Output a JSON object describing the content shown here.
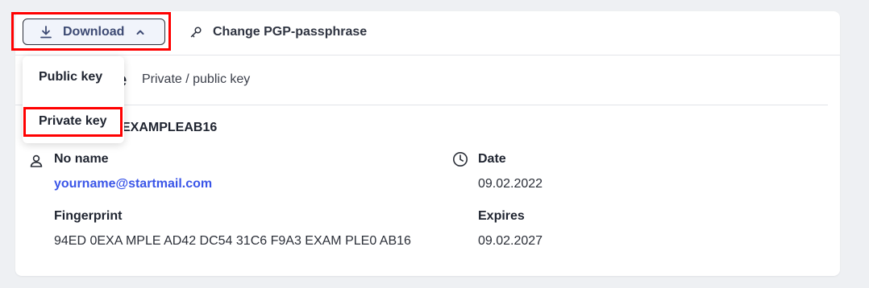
{
  "toolbar": {
    "download_label": "Download",
    "download_icon": "download-icon",
    "download_chevron_icon": "chevron-up-icon",
    "change_passphrase_label": "Change PGP-passphrase",
    "change_passphrase_icon": "key-icon"
  },
  "dropdown": {
    "items": [
      {
        "label": "Public key"
      },
      {
        "label": "Private key"
      }
    ]
  },
  "key": {
    "title_visible": "e",
    "subtitle": "Private / public key",
    "id_visible": "EXAMPLEAB16",
    "owner_name": "No name",
    "owner_icon": "user-icon",
    "email": "yourname@startmail.com",
    "fingerprint_label": "Fingerprint",
    "fingerprint": "94ED 0EXA MPLE AD42 DC54 31C6 F9A3 EXAM PLE0 AB16",
    "date_label": "Date",
    "date_icon": "clock-icon",
    "date": "09.02.2022",
    "expires_label": "Expires",
    "expires": "09.02.2027"
  },
  "colors": {
    "highlight": "#ff0000",
    "link": "#3a55e8",
    "button_bg": "#f1f4fb",
    "page_bg": "#eef0f3"
  }
}
